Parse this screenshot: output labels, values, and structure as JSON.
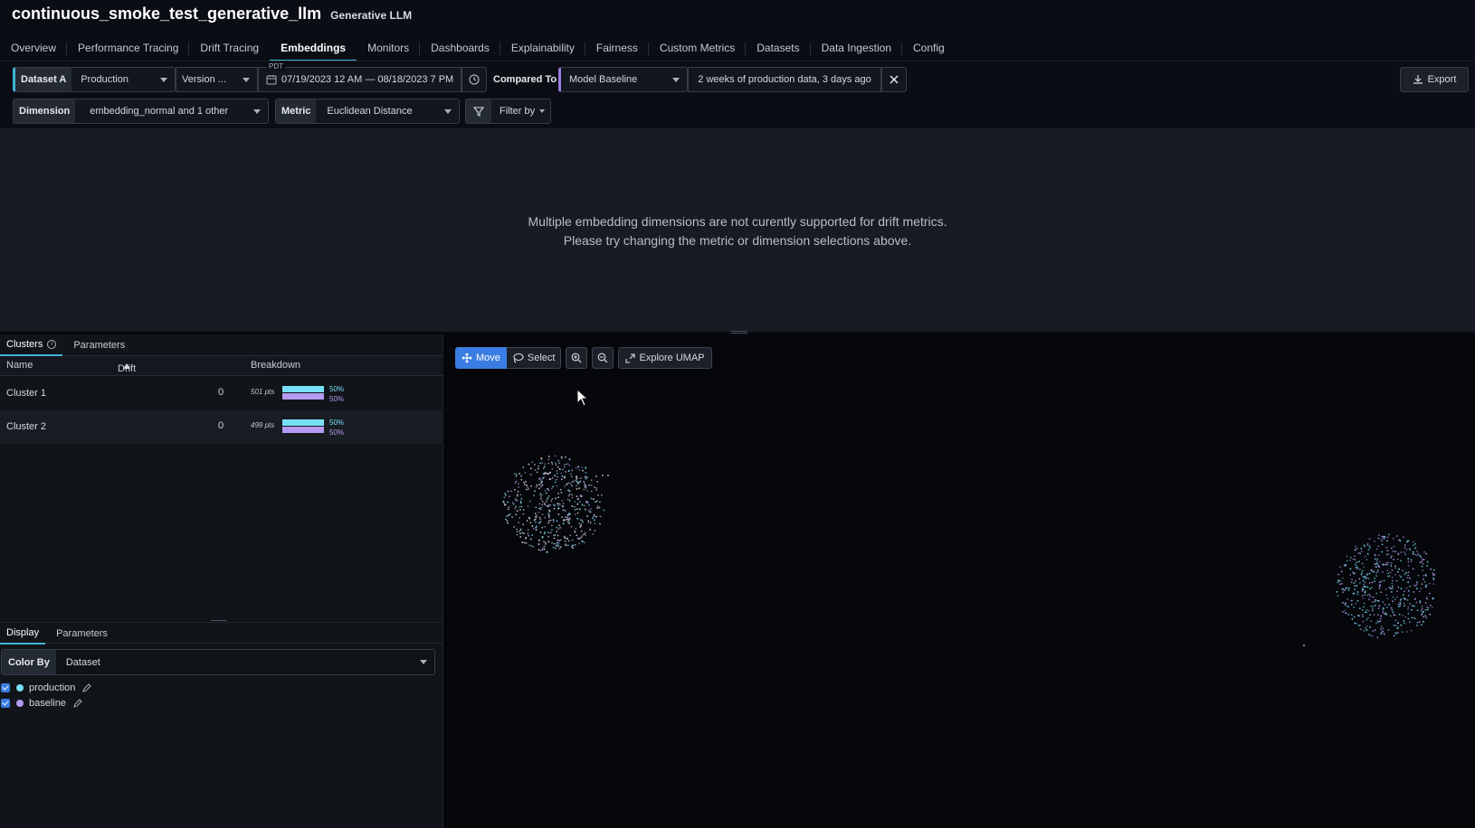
{
  "header": {
    "model_name": "continuous_smoke_test_generative_llm",
    "model_type": "Generative LLM"
  },
  "tabs": [
    {
      "label": "Overview",
      "active": false
    },
    {
      "label": "Performance Tracing",
      "active": false
    },
    {
      "label": "Drift Tracing",
      "active": false
    },
    {
      "label": "Embeddings",
      "active": true
    },
    {
      "label": "Monitors",
      "active": false
    },
    {
      "label": "Dashboards",
      "active": false
    },
    {
      "label": "Explainability",
      "active": false
    },
    {
      "label": "Fairness",
      "active": false
    },
    {
      "label": "Custom Metrics",
      "active": false
    },
    {
      "label": "Datasets",
      "active": false
    },
    {
      "label": "Data Ingestion",
      "active": false
    },
    {
      "label": "Config",
      "active": false
    }
  ],
  "filters": {
    "dataset_a_label": "Dataset A",
    "dataset_a_value": "Production",
    "version_value": "Version ...",
    "timezone": "PDT",
    "date_range": "07/19/2023 12 AM — 08/18/2023 7 PM",
    "compared_to_label": "Compared To",
    "compared_value": "Model Baseline",
    "baseline_description": "2 weeks of production data, 3 days ago",
    "export_label": "Export",
    "dimension_label": "Dimension",
    "dimension_value": "embedding_normal and 1 other",
    "metric_label": "Metric",
    "metric_value": "Euclidean Distance",
    "filter_label": "Filter by"
  },
  "drift_message": {
    "line1": "Multiple embedding dimensions are not curently supported for drift metrics.",
    "line2": "Please try changing the metric or dimension selections above."
  },
  "clusters_panel": {
    "tab_clusters": "Clusters",
    "tab_parameters": "Parameters",
    "col_name": "Name",
    "col_drift": "Drift",
    "col_breakdown": "Breakdown",
    "rows": [
      {
        "name": "Cluster 1",
        "drift": "0",
        "points": "501 pts",
        "pct_a": "50%",
        "pct_b": "50%",
        "share_a": 0.5,
        "share_b": 0.5
      },
      {
        "name": "Cluster 2",
        "drift": "0",
        "points": "499 pts",
        "pct_a": "50%",
        "pct_b": "50%",
        "share_a": 0.5,
        "share_b": 0.5
      }
    ]
  },
  "display_panel": {
    "tab_display": "Display",
    "tab_parameters": "Parameters",
    "color_by_label": "Color By",
    "color_by_value": "Dataset",
    "legend": [
      {
        "label": "production",
        "color": "#78e0f6",
        "checked": true
      },
      {
        "label": "baseline",
        "color": "#b49af0",
        "checked": true
      }
    ]
  },
  "toolbar": {
    "move": "Move",
    "select": "Select",
    "explore": "Explore UMAP"
  },
  "colors": {
    "accent": "#3fb3d8",
    "active_button": "#3a7de2",
    "production": "#78e0f6",
    "baseline": "#b49af0"
  }
}
